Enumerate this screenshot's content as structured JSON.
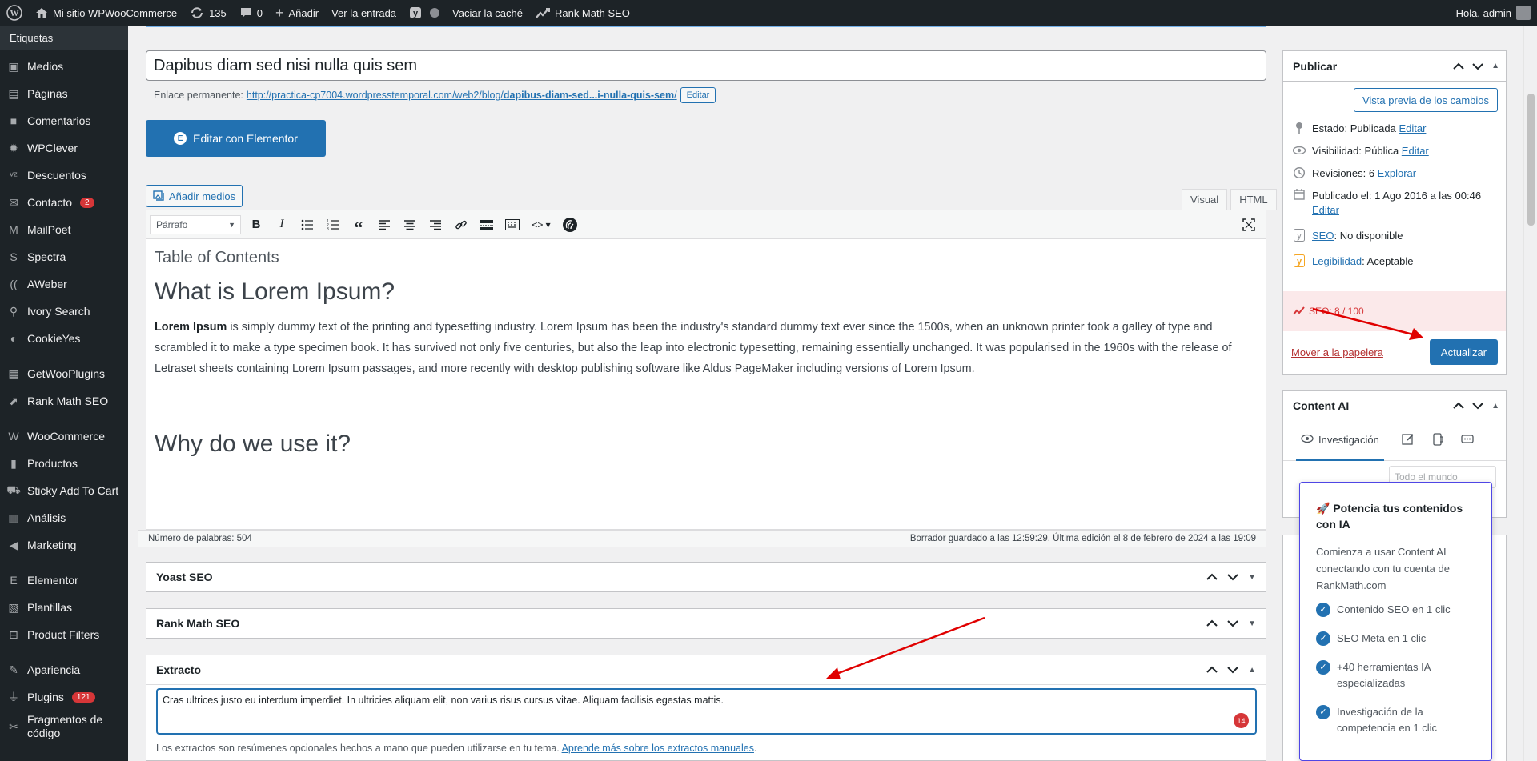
{
  "adminbar": {
    "site_name": "Mi sitio WPWooCommerce",
    "updates_count": "135",
    "comments_count": "0",
    "add_new": "Añadir",
    "view_entry": "Ver la entrada",
    "clear_cache": "Vaciar la caché",
    "rank_math": "Rank Math SEO",
    "greeting": "Hola, admin"
  },
  "sidebar": {
    "top_item": "Etiquetas",
    "items": [
      {
        "label": "Medios",
        "icon": "media-icon"
      },
      {
        "label": "Páginas",
        "icon": "pages-icon"
      },
      {
        "label": "Comentarios",
        "icon": "comments-icon"
      },
      {
        "label": "WPClever",
        "icon": "wpclever-icon"
      },
      {
        "label": "Descuentos",
        "icon": "discounts-icon"
      },
      {
        "label": "Contacto",
        "icon": "mail-icon",
        "badge": "2"
      },
      {
        "label": "MailPoet",
        "icon": "mailpoet-icon"
      },
      {
        "label": "Spectra",
        "icon": "spectra-icon"
      },
      {
        "label": "AWeber",
        "icon": "aweber-icon"
      },
      {
        "label": "Ivory Search",
        "icon": "search-icon"
      },
      {
        "label": "CookieYes",
        "icon": "cookie-icon"
      },
      {
        "label": "GetWooPlugins",
        "icon": "grid-icon"
      },
      {
        "label": "Rank Math SEO",
        "icon": "rankmath-icon"
      },
      {
        "label": "WooCommerce",
        "icon": "woo-icon"
      },
      {
        "label": "Productos",
        "icon": "products-icon"
      },
      {
        "label": "Sticky Add To Cart",
        "icon": "cart-icon"
      },
      {
        "label": "Análisis",
        "icon": "analytics-icon"
      },
      {
        "label": "Marketing",
        "icon": "megaphone-icon"
      },
      {
        "label": "Elementor",
        "icon": "elementor-icon"
      },
      {
        "label": "Plantillas",
        "icon": "templates-icon"
      },
      {
        "label": "Product Filters",
        "icon": "filter-icon"
      },
      {
        "label": "Apariencia",
        "icon": "brush-icon"
      },
      {
        "label": "Plugins",
        "icon": "plugin-icon",
        "badge": "121"
      },
      {
        "label": "Fragmentos de código",
        "icon": "code-icon"
      }
    ]
  },
  "editor": {
    "title": "Dapibus diam sed nisi nulla quis sem",
    "permalink_label": "Enlace permanente:",
    "permalink_url_start": "http://practica-cp7004.wordpresstemporal.com/web2/blog/",
    "permalink_slug": "dapibus-diam-sed...i-nulla-quis-sem",
    "permalink_url_end": "/",
    "edit_label": "Editar",
    "elementor_button": "Editar con Elementor",
    "add_media": "Añadir medios",
    "tab_visual": "Visual",
    "tab_html": "HTML",
    "format_select": "Párrafo",
    "toc": "Table of Contents",
    "heading1": "What is Lorem Ipsum?",
    "para_bold": "Lorem Ipsum",
    "para_rest": " is simply dummy text of the printing and typesetting industry. Lorem Ipsum has been the industry's standard dummy text ever since the 1500s, when an unknown printer took a galley of type and scrambled it to make a type specimen book. It has survived not only five centuries, but also the leap into electronic typesetting, remaining essentially unchanged. It was popularised in the 1960s with the release of Letraset sheets containing Lorem Ipsum passages, and more recently with desktop publishing software like Aldus PageMaker including versions of Lorem Ipsum.",
    "heading2": "Why do we use it?",
    "word_count": "Número de palabras: 504",
    "draft_saved": "Borrador guardado a las 12:59:29. Última edición el 8 de febrero de 2024 a las 19:09"
  },
  "metaboxes": {
    "yoast": "Yoast SEO",
    "rankmath": "Rank Math SEO",
    "excerpt": "Extracto"
  },
  "excerpt": {
    "text": "Cras ultrices justo eu interdum imperdiet. In ultricies aliquam elit, non varius risus cursus vitae. Aliquam facilisis egestas mattis.",
    "counter": "14",
    "help_text": "Los extractos son resúmenes opcionales hechos a mano que pueden utilizarse en tu tema. ",
    "help_link": "Aprende más sobre los extractos manuales",
    "help_end": "."
  },
  "publish": {
    "title": "Publicar",
    "preview": "Vista previa de los cambios",
    "status_label": "Estado: ",
    "status_value": "Publicada",
    "visibility_label": "Visibilidad: ",
    "visibility_value": "Pública",
    "revisions_label": "Revisiones: ",
    "revisions_value": "6",
    "explore": "Explorar",
    "published_label": "Publicado el: ",
    "published_value": "1 Ago 2016 a las 00:46",
    "seo_label": "SEO",
    "seo_value": ": No disponible",
    "readability_label": "Legibilidad",
    "readability_value": ": Aceptable",
    "seo_score": "SEO: 8 / 100",
    "trash": "Mover a la papelera",
    "update": "Actualizar",
    "edit": "Editar"
  },
  "content_ai": {
    "title": "Content AI",
    "tab_research": "Investigación",
    "region": "Todo el mundo"
  },
  "popup": {
    "title": "Potencia tus contenidos con IA",
    "description": "Comienza a usar Content AI conectando con tu cuenta de RankMath.com",
    "features": [
      "Contenido SEO en 1 clic",
      "SEO Meta en 1 clic",
      "+40 herramientas IA especializadas",
      "Investigación de la competencia en 1 clic"
    ]
  },
  "colors": {
    "wp_blue": "#2271b1",
    "admin_dark": "#1d2327",
    "error_red": "#d63638",
    "arrow_red": "#e00000"
  }
}
